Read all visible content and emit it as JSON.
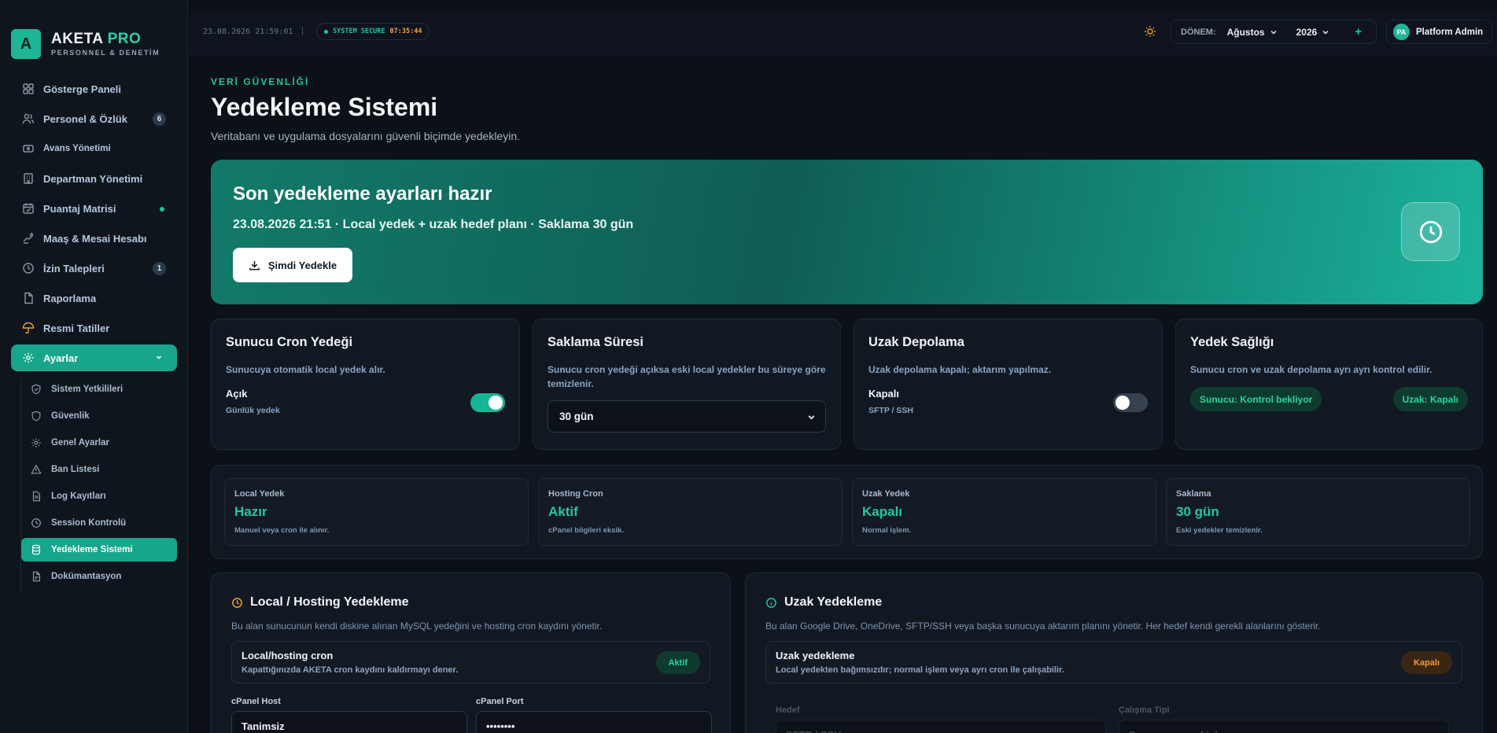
{
  "brand": {
    "logo_letter": "A",
    "name": "AKETA",
    "name_accent": "PRO",
    "subtitle": "PERSONNEL & DENETİM"
  },
  "sidebar": {
    "items": [
      {
        "label": "Gösterge Paneli",
        "icon": "grid-icon"
      },
      {
        "label": "Personel & Özlük",
        "icon": "users-icon",
        "badge": "6"
      },
      {
        "label": "Avans Yönetimi",
        "icon": "wallet-icon"
      },
      {
        "label": "Departman Yönetimi",
        "icon": "building-icon"
      },
      {
        "label": "Puantaj Matrisi",
        "icon": "calendar-check-icon",
        "dot": true
      },
      {
        "label": "Maaş & Mesai Hesabı",
        "icon": "hand-coins-icon"
      },
      {
        "label": "İzin Talepleri",
        "icon": "clock-icon",
        "badge": "1"
      },
      {
        "label": "Raporlama",
        "icon": "file-chart-icon"
      },
      {
        "label": "Resmi Tatiller",
        "icon": "umbrella-icon"
      },
      {
        "label": "Ayarlar",
        "icon": "gear-icon",
        "active": true
      }
    ],
    "subitems": [
      {
        "label": "Sistem Yetkilileri",
        "icon": "shield-icon"
      },
      {
        "label": "Güvenlik",
        "icon": "shield-icon"
      },
      {
        "label": "Genel Ayarlar",
        "icon": "gear-icon"
      },
      {
        "label": "Ban Listesi",
        "icon": "warning-icon"
      },
      {
        "label": "Log Kayıtları",
        "icon": "file-text-icon"
      },
      {
        "label": "Session Kontrolü",
        "icon": "clock-icon"
      },
      {
        "label": "Yedekleme Sistemi",
        "icon": "database-icon",
        "active": true
      },
      {
        "label": "Dokümantasyon",
        "icon": "document-icon"
      }
    ]
  },
  "topbar": {
    "datetime": "23.08.2026 21:59:01",
    "separator": "|",
    "secure_label": "SYSTEM SECURE",
    "secure_time": "07:35:44",
    "period_label": "DÖNEM:",
    "month": "Ağustos",
    "year": "2026",
    "add": "+",
    "user_initials": "PA",
    "user_name": "Platform Admin"
  },
  "page": {
    "eyebrow": "VERİ GÜVENLİĞİ",
    "title": "Yedekleme Sistemi",
    "subtitle": "Veritabanı ve uygulama dosyalarını güvenli biçimde yedekleyin."
  },
  "hero": {
    "title": "Son yedekleme ayarları hazır",
    "subtitle": "23.08.2026 21:51 · Local yedek + uzak hedef planı · Saklama 30 gün",
    "button": "Şimdi Yedekle"
  },
  "cards": {
    "cron": {
      "title": "Sunucu Cron Yedeği",
      "desc": "Sunucuya otomatik local yedek alır.",
      "state": "Açık",
      "state_sub": "Günlük yedek",
      "enabled": true
    },
    "retention": {
      "title": "Saklama Süresi",
      "desc": "Sunucu cron yedeği açıksa eski local yedekler bu süreye göre temizlenir.",
      "selected": "30 gün"
    },
    "remote": {
      "title": "Uzak Depolama",
      "desc": "Uzak depolama kapalı; aktarım yapılmaz.",
      "state": "Kapalı",
      "state_sub": "SFTP / SSH",
      "enabled": false
    },
    "health": {
      "title": "Yedek Sağlığı",
      "desc": "Sunucu cron ve uzak depolama ayrı ayrı kontrol edilir.",
      "server_status": "Sunucu: Kontrol bekliyor",
      "remote_status": "Uzak: Kapalı"
    }
  },
  "stats": [
    {
      "label": "Local Yedek",
      "value": "Hazır",
      "sub": "Manuel veya cron ile alınır."
    },
    {
      "label": "Hosting Cron",
      "value": "Aktif",
      "sub": "cPanel bilgileri eksik."
    },
    {
      "label": "Uzak Yedek",
      "value": "Kapalı",
      "sub": "Normal işlem."
    },
    {
      "label": "Saklama",
      "value": "30 gün",
      "sub": "Eski yedekler temizlenir."
    }
  ],
  "local_panel": {
    "title": "Local / Hosting Yedekleme",
    "desc": "Bu alan sunucunun kendi diskine alınan MySQL yedeğini ve hosting cron kaydını yönetir.",
    "row_title": "Local/hosting cron",
    "row_sub": "Kapattığınızda AKETA cron kaydını kaldırmayı dener.",
    "row_status": "Aktif",
    "host_label": "cPanel Host",
    "host_value": "Tanimsiz",
    "port_label": "cPanel Port",
    "port_value": "••••••••"
  },
  "remote_panel": {
    "title": "Uzak Yedekleme",
    "desc": "Bu alan Google Drive, OneDrive, SFTP/SSH veya başka sunucuya aktarım planını yönetir. Her hedef kendi gerekli alanlarını gösterir.",
    "row_title": "Uzak yedekleme",
    "row_sub": "Local yedekten bağımsızdır; normal işlem veya ayrı cron ile çalışabilir.",
    "row_status": "Kapalı",
    "target_label": "Hedef",
    "target_value": "SFTP / SSH",
    "type_label": "Çalışma Tipi",
    "type_value": "Sunucu normal işlem"
  },
  "colors": {
    "accent": "#1ec59f",
    "warning": "#f39a3e",
    "bg": "#0c1118"
  }
}
